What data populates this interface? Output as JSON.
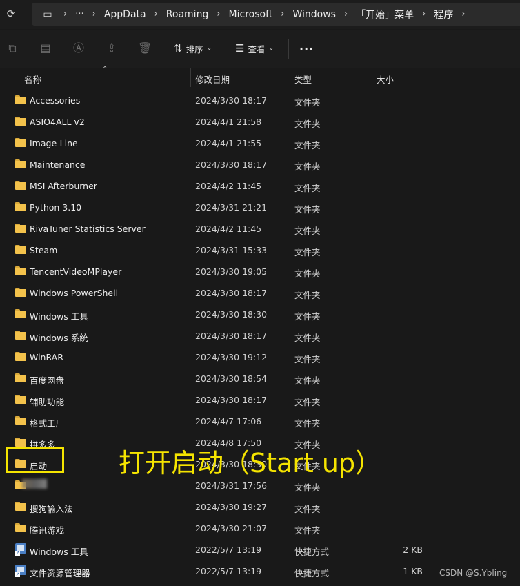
{
  "breadcrumb": {
    "items": [
      "AppData",
      "Roaming",
      "Microsoft",
      "Windows",
      "「开始」菜单",
      "程序"
    ],
    "more": "···",
    "sep": "›"
  },
  "toolbar": {
    "sort_label": "排序",
    "view_label": "查看",
    "more_label": "···"
  },
  "columns": {
    "name": "名称",
    "date": "修改日期",
    "type": "类型",
    "size": "大小"
  },
  "rows": [
    {
      "name": "Accessories",
      "date": "2024/3/30 18:17",
      "type": "文件夹",
      "size": "",
      "icon": "folder"
    },
    {
      "name": "ASIO4ALL v2",
      "date": "2024/4/1 21:58",
      "type": "文件夹",
      "size": "",
      "icon": "folder"
    },
    {
      "name": "Image-Line",
      "date": "2024/4/1 21:55",
      "type": "文件夹",
      "size": "",
      "icon": "folder"
    },
    {
      "name": "Maintenance",
      "date": "2024/3/30 18:17",
      "type": "文件夹",
      "size": "",
      "icon": "folder"
    },
    {
      "name": "MSI Afterburner",
      "date": "2024/4/2 11:45",
      "type": "文件夹",
      "size": "",
      "icon": "folder"
    },
    {
      "name": "Python 3.10",
      "date": "2024/3/31 21:21",
      "type": "文件夹",
      "size": "",
      "icon": "folder"
    },
    {
      "name": "RivaTuner Statistics Server",
      "date": "2024/4/2 11:45",
      "type": "文件夹",
      "size": "",
      "icon": "folder"
    },
    {
      "name": "Steam",
      "date": "2024/3/31 15:33",
      "type": "文件夹",
      "size": "",
      "icon": "folder"
    },
    {
      "name": "TencentVideoMPlayer",
      "date": "2024/3/30 19:05",
      "type": "文件夹",
      "size": "",
      "icon": "folder"
    },
    {
      "name": "Windows PowerShell",
      "date": "2024/3/30 18:17",
      "type": "文件夹",
      "size": "",
      "icon": "folder"
    },
    {
      "name": "Windows 工具",
      "date": "2024/3/30 18:30",
      "type": "文件夹",
      "size": "",
      "icon": "folder"
    },
    {
      "name": "Windows 系统",
      "date": "2024/3/30 18:17",
      "type": "文件夹",
      "size": "",
      "icon": "folder"
    },
    {
      "name": "WinRAR",
      "date": "2024/3/30 19:12",
      "type": "文件夹",
      "size": "",
      "icon": "folder"
    },
    {
      "name": "百度网盘",
      "date": "2024/3/30 18:54",
      "type": "文件夹",
      "size": "",
      "icon": "folder"
    },
    {
      "name": "辅助功能",
      "date": "2024/3/30 18:17",
      "type": "文件夹",
      "size": "",
      "icon": "folder"
    },
    {
      "name": "格式工厂",
      "date": "2024/4/7 17:06",
      "type": "文件夹",
      "size": "",
      "icon": "folder"
    },
    {
      "name": "拼多多",
      "date": "2024/4/8 17:50",
      "type": "文件夹",
      "size": "",
      "icon": "folder"
    },
    {
      "name": "启动",
      "date": "2024/3/30 18:30",
      "type": "文件夹",
      "size": "",
      "icon": "folder"
    },
    {
      "name": "",
      "date": "2024/3/31 17:56",
      "type": "文件夹",
      "size": "",
      "icon": "folder-blurred"
    },
    {
      "name": "搜狗输入法",
      "date": "2024/3/30 19:27",
      "type": "文件夹",
      "size": "",
      "icon": "folder"
    },
    {
      "name": "腾讯游戏",
      "date": "2024/3/30 21:07",
      "type": "文件夹",
      "size": "",
      "icon": "folder"
    },
    {
      "name": "Windows 工具",
      "date": "2022/5/7 13:19",
      "type": "快捷方式",
      "size": "2 KB",
      "icon": "shortcut-tools"
    },
    {
      "name": "文件资源管理器",
      "date": "2022/5/7 13:19",
      "type": "快捷方式",
      "size": "1 KB",
      "icon": "shortcut-explorer"
    }
  ],
  "annotation": {
    "text": "打开启动（Start up）",
    "color": "#f5e400"
  },
  "watermark": "CSDN @S.Ybling"
}
